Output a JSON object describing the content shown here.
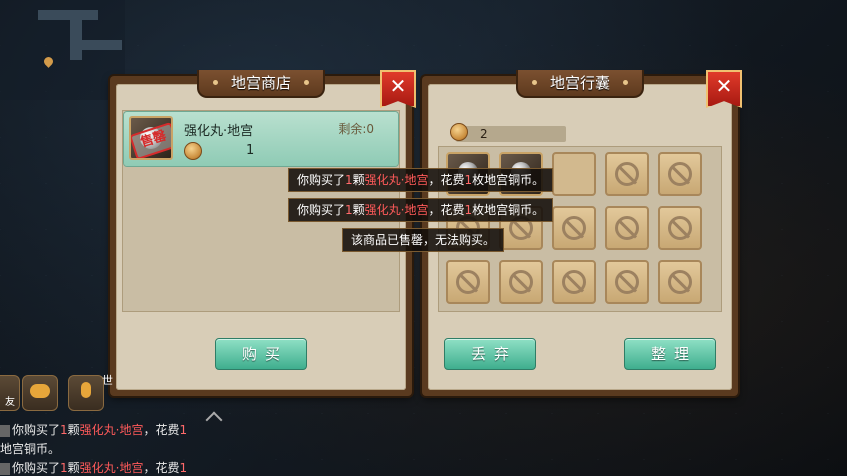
{
  "shop": {
    "title": "地宫商店",
    "close_glyph": "✕",
    "item": {
      "name": "强化丸·地宫",
      "remain": "剩余:0",
      "price": "1",
      "badge": "售罄"
    },
    "buy_label": "购买"
  },
  "bag": {
    "title": "地宫行囊",
    "close_glyph": "✕",
    "coins": "2",
    "discard_label": "丢弃",
    "sort_label": "整理",
    "slots": [
      "filled",
      "filled",
      "open",
      "locked",
      "locked",
      "locked",
      "locked",
      "locked",
      "locked",
      "locked",
      "locked",
      "locked",
      "locked",
      "locked",
      "locked"
    ]
  },
  "toasts": [
    {
      "pre": "你购买了",
      "count": "1",
      "mid": "颗",
      "item": "强化丸·地宫",
      "mid2": "，花费",
      "cost": "1",
      "post": "枚地宫铜币。"
    },
    {
      "pre": "你购买了",
      "count": "1",
      "mid": "颗",
      "item": "强化丸·地宫",
      "mid2": "，花费",
      "cost": "1",
      "post": "枚地宫铜币。"
    },
    {
      "text": "该商品已售罄，无法购买。"
    }
  ],
  "chat": {
    "side_label": "世",
    "left_label": "友",
    "lines": [
      {
        "pre": "你购买了",
        "count": "1",
        "mid": "颗",
        "item": "强化丸·地宫",
        "post": "，花费",
        "cost": "1"
      },
      {
        "pre": "地宫铜币。"
      },
      {
        "pre": "你购买了",
        "count": "1",
        "mid": "颗",
        "item": "强化丸·地宫",
        "post": "，花费",
        "cost": "1"
      }
    ]
  },
  "icons": {
    "coin": "copper-coin-icon",
    "ban": "forbidden-icon",
    "chat": "chat-bubble-icon",
    "mic": "microphone-icon",
    "pin": "map-pin-icon"
  }
}
